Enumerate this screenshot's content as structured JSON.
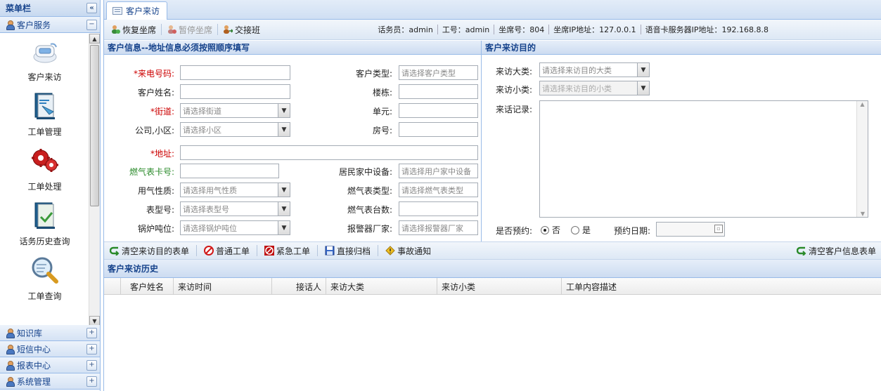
{
  "sidebar": {
    "title": "菜单栏",
    "collapse_symbol": "«",
    "active_section": "客户服务",
    "active_toggle": "−",
    "menu": [
      {
        "label": "客户来访",
        "icon": "phone-icon"
      },
      {
        "label": "工单管理",
        "icon": "ticket-book-icon"
      },
      {
        "label": "工单处理",
        "icon": "gears-icon"
      },
      {
        "label": "话务历史查询",
        "icon": "history-book-icon"
      },
      {
        "label": "工单查询",
        "icon": "magnifier-icon"
      }
    ],
    "sections": [
      {
        "label": "知识库",
        "toggle": "+"
      },
      {
        "label": "短信中心",
        "toggle": "+"
      },
      {
        "label": "报表中心",
        "toggle": "+"
      },
      {
        "label": "系统管理",
        "toggle": "+"
      }
    ]
  },
  "tab": {
    "label": "客户来访"
  },
  "toolbar": {
    "restore_seat": "恢复坐席",
    "pause_seat": "暂停坐席",
    "handover": "交接班",
    "agent_info": {
      "operator": "话务员：admin",
      "job_no": "工号：admin",
      "seat_no": "坐席号：804",
      "seat_ip": "坐席IP地址：127.0.0.1",
      "voice_server_ip": "语音卡服务器IP地址：192.168.8.8"
    }
  },
  "customer_panel": {
    "title": "客户信息--地址信息必须按照顺序填写",
    "fields": {
      "phone_label": "*来电号码:",
      "name_label": "客户姓名:",
      "street_label": "*街道:",
      "street_placeholder": "请选择街道",
      "company_label": "公司,小区:",
      "company_placeholder": "请选择小区",
      "address_label": "*地址:",
      "gas_card_label": "燃气表卡号:",
      "gas_nature_label": "用气性质:",
      "gas_nature_placeholder": "请选择用气性质",
      "meter_model_label": "表型号:",
      "meter_model_placeholder": "请选择表型号",
      "boiler_label": "锅炉吨位:",
      "boiler_placeholder": "请选择锅炉吨位",
      "cust_type_label": "客户类型:",
      "cust_type_placeholder": "请选择客户类型",
      "building_label": "楼栋:",
      "unit_label": "单元:",
      "room_label": "房号:",
      "home_device_label": "居民家中设备:",
      "home_device_placeholder": "请选择用户家中设备",
      "meter_type_label": "燃气表类型:",
      "meter_type_placeholder": "请选择燃气表类型",
      "meter_count_label": "燃气表台数:",
      "alarm_vendor_label": "报警器厂家:",
      "alarm_vendor_placeholder": "请选择报警器厂家"
    }
  },
  "purpose_panel": {
    "title": "客户来访目的",
    "category_label": "来访大类:",
    "category_placeholder": "请选择来访目的大类",
    "subcategory_label": "来访小类:",
    "subcategory_placeholder": "请选择来访目的小类",
    "record_label": "来话记录:",
    "appointment_label": "是否预约:",
    "option_no": "否",
    "option_yes": "是",
    "appointment_date_label": "预约日期:"
  },
  "actions": {
    "clear_purpose": "清空来访目的表单",
    "normal_ticket": "普通工单",
    "urgent_ticket": "紧急工单",
    "direct_archive": "直接归档",
    "incident_notice": "事故通知",
    "clear_customer": "清空客户信息表单"
  },
  "history": {
    "title": "客户来访历史",
    "columns": [
      "客户姓名",
      "来访时间",
      "接话人",
      "来访大类",
      "来访小类",
      "工单内容描述"
    ]
  }
}
